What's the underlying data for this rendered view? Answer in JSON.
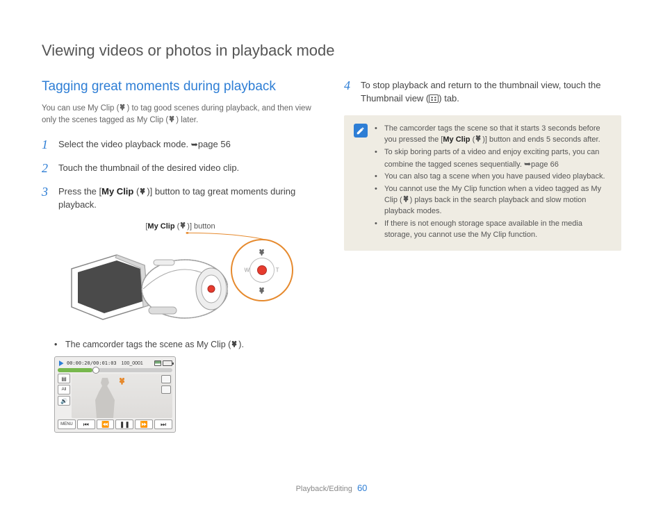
{
  "page_title": "Viewing videos or photos in playback mode",
  "section_title": "Tagging great moments during playback",
  "intro_a": "You can use My Clip (",
  "intro_b": ") to tag good scenes during playback, and then view only the scenes tagged as My Clip (",
  "intro_c": ") later.",
  "steps": {
    "s1": {
      "num": "1",
      "a": "Select the video playback mode. ",
      "b": "page 56"
    },
    "s2": {
      "num": "2",
      "text": "Touch the thumbnail of the desired video clip."
    },
    "s3": {
      "num": "3",
      "a": "Press the [",
      "b": "My Clip",
      "c": " (",
      "d": ")] button to tag great moments during playback."
    },
    "s4": {
      "num": "4",
      "a": "To stop playback and return to the thumbnail view, touch the Thumbnail view (",
      "b": ") tab."
    }
  },
  "callout": {
    "a": "[",
    "b": "My Clip",
    "c": " (",
    "d": ")] button"
  },
  "magnifier": {
    "w": "W",
    "t": "T"
  },
  "bullet_tag": {
    "a": "The camcorder tags the scene as My Clip (",
    "b": ")."
  },
  "screenshot": {
    "time": "00:00:20/00:01:03",
    "folder": "100_0001",
    "left_tags": [
      "▤",
      "All",
      "🔊"
    ],
    "menu": "MENU",
    "controls": [
      "⏮",
      "⏪",
      "❚❚",
      "⏩",
      "⏭"
    ]
  },
  "notes": {
    "n1": {
      "a": "The camcorder tags the scene so that it starts 3 seconds before you pressed the [",
      "b": "My Clip",
      "c": " (",
      "d": ")] button and ends 5 seconds after."
    },
    "n2": {
      "a": "To skip boring parts of a video and enjoy exciting parts, you can combine the tagged scenes sequentially. ",
      "b": "page 66"
    },
    "n3": "You can also tag a scene when you have paused video playback.",
    "n4": {
      "a": "You cannot use the My Clip function when a video tagged as My Clip (",
      "b": ") plays back in the search playback and slow motion playback modes."
    },
    "n5": "If there is not enough storage space available in the media storage, you cannot use the My Clip function."
  },
  "footer": {
    "section": "Playback/Editing",
    "page": "60"
  }
}
